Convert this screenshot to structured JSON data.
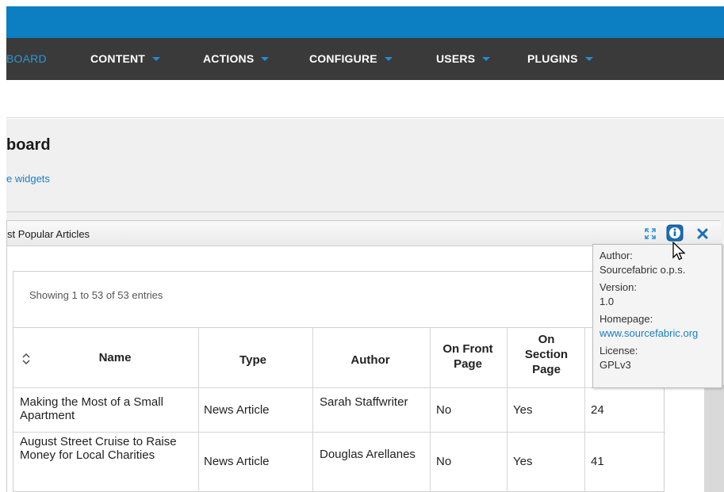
{
  "nav": {
    "items": [
      {
        "label": "BOARD"
      },
      {
        "label": "CONTENT"
      },
      {
        "label": "ACTIONS"
      },
      {
        "label": "CONFIGURE"
      },
      {
        "label": "USERS"
      },
      {
        "label": "PLUGINS"
      }
    ]
  },
  "page": {
    "title": "board",
    "widgets_link": "e widgets"
  },
  "widget": {
    "title": "st Popular Articles",
    "showing": "Showing 1 to 53 of 53 entries",
    "columns": [
      "Name",
      "Type",
      "Author",
      "On Front Page",
      "On Section Page"
    ],
    "rows": [
      {
        "name": "Making the Most of a Small Apartment",
        "type": "News Article",
        "author": "Sarah Staffwriter",
        "front": "No",
        "section": "Yes",
        "hits": "24"
      },
      {
        "name": "August Street Cruise to Raise Money for Local Charities",
        "type": "News Article",
        "author": "Douglas Arellanes",
        "front": "No",
        "section": "Yes",
        "hits": "41"
      }
    ]
  },
  "tooltip": {
    "author_label": "Author:",
    "author": "Sourcefabric o.p.s.",
    "version_label": "Version:",
    "version": "1.0",
    "homepage_label": "Homepage:",
    "homepage": "www.sourcefabric.org",
    "license_label": "License:",
    "license": "GPLv3"
  },
  "colors": {
    "accent": "#0b7fc1",
    "nav_bg": "#3a3a3a",
    "link": "#1a7ec5"
  }
}
